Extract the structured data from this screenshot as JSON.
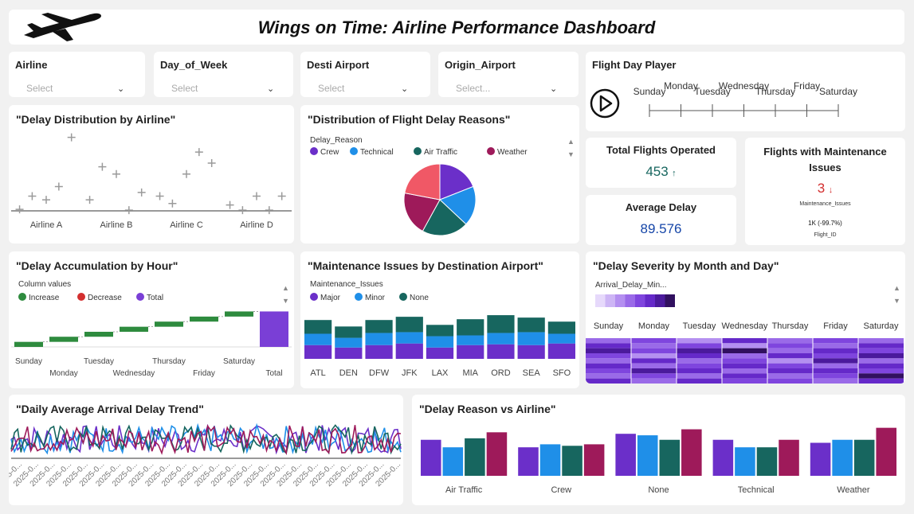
{
  "header": {
    "title": "Wings on Time: Airline Performance Dashboard"
  },
  "filters": [
    {
      "label": "Airline",
      "placeholder": "Select"
    },
    {
      "label": "Day_of_Week",
      "placeholder": "Select"
    },
    {
      "label": "Desti Airport",
      "placeholder": "Select"
    },
    {
      "label": "Origin_Airport",
      "placeholder": "Select..."
    }
  ],
  "player": {
    "title": "Flight Day Player",
    "days": [
      "Sunday",
      "Monday",
      "Tuesday",
      "Wednesday",
      "Thursday",
      "Friday",
      "Saturday"
    ]
  },
  "kpis": {
    "total": {
      "title": "Total Flights Operated",
      "value": "453",
      "arrow": "↑"
    },
    "maintenance": {
      "title": "Flights with Maintenance Issues",
      "value": "3",
      "arrow": "↓",
      "sub": "Maintenance_Issues",
      "goal": "1K (-99.7%)",
      "goal_label": "Flight_ID"
    },
    "avg": {
      "title": "Average Delay",
      "value": "89.576"
    }
  },
  "colors": {
    "purple": "#6b2fc9",
    "blue": "#1f8fe8",
    "teal": "#17665f",
    "maroon": "#9e1a5a",
    "red": "#f05866",
    "green": "#2e8b3e",
    "darkred": "#d32f2f"
  },
  "chart_data": [
    {
      "id": "delay_distribution",
      "type": "scatter",
      "title": "\"Delay Distribution by Airline\"",
      "categories": [
        "Airline A",
        "Airline B",
        "Airline C",
        "Airline D"
      ],
      "points": [
        {
          "cat": 0,
          "offset": -0.38,
          "y": 0.2
        },
        {
          "cat": 0,
          "offset": -0.2,
          "y": 2.0
        },
        {
          "cat": 0,
          "offset": 0.0,
          "y": 1.5
        },
        {
          "cat": 0,
          "offset": 0.18,
          "y": 3.3
        },
        {
          "cat": 0,
          "offset": 0.36,
          "y": 10.0
        },
        {
          "cat": 1,
          "offset": -0.38,
          "y": 1.5
        },
        {
          "cat": 1,
          "offset": -0.2,
          "y": 6.0
        },
        {
          "cat": 1,
          "offset": 0.0,
          "y": 5.0
        },
        {
          "cat": 1,
          "offset": 0.18,
          "y": 0.1
        },
        {
          "cat": 1,
          "offset": 0.36,
          "y": 2.5
        },
        {
          "cat": 2,
          "offset": -0.38,
          "y": 2.0
        },
        {
          "cat": 2,
          "offset": -0.2,
          "y": 1.0
        },
        {
          "cat": 2,
          "offset": 0.0,
          "y": 5.0
        },
        {
          "cat": 2,
          "offset": 0.18,
          "y": 8.0
        },
        {
          "cat": 2,
          "offset": 0.36,
          "y": 6.5
        },
        {
          "cat": 3,
          "offset": -0.38,
          "y": 0.8
        },
        {
          "cat": 3,
          "offset": -0.2,
          "y": 0.1
        },
        {
          "cat": 3,
          "offset": 0.0,
          "y": 2.0
        },
        {
          "cat": 3,
          "offset": 0.18,
          "y": 0.1
        },
        {
          "cat": 3,
          "offset": 0.36,
          "y": 2.0
        }
      ],
      "ylim": [
        0,
        10.5
      ]
    },
    {
      "id": "delay_reasons",
      "type": "pie",
      "title": "\"Distribution of Flight Delay Reasons\"",
      "legend_title": "Delay_Reason",
      "slices": [
        {
          "name": "Crew",
          "value": 19,
          "color": "#6b2fc9"
        },
        {
          "name": "Technical",
          "value": 18,
          "color": "#1f8fe8"
        },
        {
          "name": "Air Traffic",
          "value": 21,
          "color": "#17665f"
        },
        {
          "name": "Weather",
          "value": 20,
          "color": "#9e1a5a"
        },
        {
          "name": "",
          "value": 22,
          "color": "#f05866"
        }
      ]
    },
    {
      "id": "delay_accumulation",
      "type": "bar",
      "subtype": "waterfall",
      "title": "\"Delay Accumulation by Hour\"",
      "legend_title": "Column values",
      "legend": [
        {
          "name": "Increase",
          "color": "#2e8b3e"
        },
        {
          "name": "Decrease",
          "color": "#d32f2f"
        },
        {
          "name": "Total",
          "color": "#7a3fd6"
        }
      ],
      "categories": [
        "Sunday",
        "Monday",
        "Tuesday",
        "Wednesday",
        "Thursday",
        "Friday",
        "Saturday",
        "Total"
      ],
      "values": [
        6200,
        6300,
        6100,
        6200,
        6300,
        6200,
        6300,
        43600
      ],
      "ylim": [
        0,
        45000
      ]
    },
    {
      "id": "maintenance_by_airport",
      "type": "bar",
      "subtype": "stacked",
      "title": "\"Maintenance Issues by Destination Airport\"",
      "legend_title": "Maintenance_Issues",
      "categories": [
        "ATL",
        "DEN",
        "DFW",
        "JFK",
        "LAX",
        "MIA",
        "ORD",
        "SEA",
        "SFO"
      ],
      "series": [
        {
          "name": "Major",
          "color": "#6b2fc9",
          "values": [
            17,
            14,
            17,
            19,
            14,
            17,
            18,
            17,
            19
          ]
        },
        {
          "name": "Minor",
          "color": "#1f8fe8",
          "values": [
            14,
            12,
            15,
            14,
            14,
            12,
            14,
            16,
            12
          ]
        },
        {
          "name": "None",
          "color": "#17665f",
          "values": [
            17,
            14,
            16,
            19,
            14,
            20,
            22,
            18,
            15
          ]
        }
      ],
      "ylim": [
        0,
        60
      ]
    },
    {
      "id": "delay_severity",
      "type": "heatmap",
      "title": "\"Delay Severity by Month and Day\"",
      "legend_title": "Arrival_Delay_Min...",
      "columns": [
        "Sunday",
        "Monday",
        "Tuesday",
        "Wednesday",
        "Thursday",
        "Friday",
        "Saturday"
      ],
      "scale": [
        "#e6d9fb",
        "#cdb5f5",
        "#b48ff0",
        "#9a6ae8",
        "#7f45de",
        "#6529c9",
        "#4b1a9c",
        "#31105f"
      ],
      "values": [
        [
          3,
          4,
          2,
          5,
          3,
          4,
          3
        ],
        [
          5,
          3,
          4,
          2,
          4,
          3,
          5
        ],
        [
          6,
          4,
          6,
          7,
          3,
          5,
          4
        ],
        [
          4,
          2,
          5,
          3,
          5,
          4,
          6
        ],
        [
          3,
          5,
          3,
          4,
          2,
          6,
          3
        ],
        [
          5,
          3,
          4,
          5,
          4,
          3,
          5
        ],
        [
          4,
          6,
          5,
          3,
          5,
          5,
          4
        ],
        [
          3,
          4,
          3,
          5,
          3,
          4,
          7
        ],
        [
          5,
          3,
          5,
          4,
          4,
          3,
          5
        ]
      ]
    },
    {
      "id": "daily_arrival_trend",
      "type": "line",
      "title": "\"Daily Average Arrival Delay Trend\"",
      "x_tick_label": "2025-0...",
      "x_tick_count": 24,
      "series_colors": [
        "#6b2fc9",
        "#1f8fe8",
        "#17665f",
        "#9e1a5a"
      ],
      "points_per_series": 120,
      "ylim": [
        0,
        100
      ]
    },
    {
      "id": "reason_vs_airline",
      "type": "bar",
      "subtype": "grouped",
      "title": "\"Delay Reason vs Airline\"",
      "categories": [
        "Air Traffic",
        "Crew",
        "None",
        "Technical",
        "Weather"
      ],
      "series": [
        {
          "color": "#6b2fc9",
          "values": [
            24,
            19,
            28,
            24,
            22
          ]
        },
        {
          "color": "#1f8fe8",
          "values": [
            19,
            21,
            27,
            19,
            24
          ]
        },
        {
          "color": "#17665f",
          "values": [
            25,
            20,
            24,
            19,
            24
          ]
        },
        {
          "color": "#9e1a5a",
          "values": [
            29,
            21,
            31,
            24,
            32
          ]
        }
      ],
      "ylim": [
        0,
        35
      ]
    }
  ]
}
